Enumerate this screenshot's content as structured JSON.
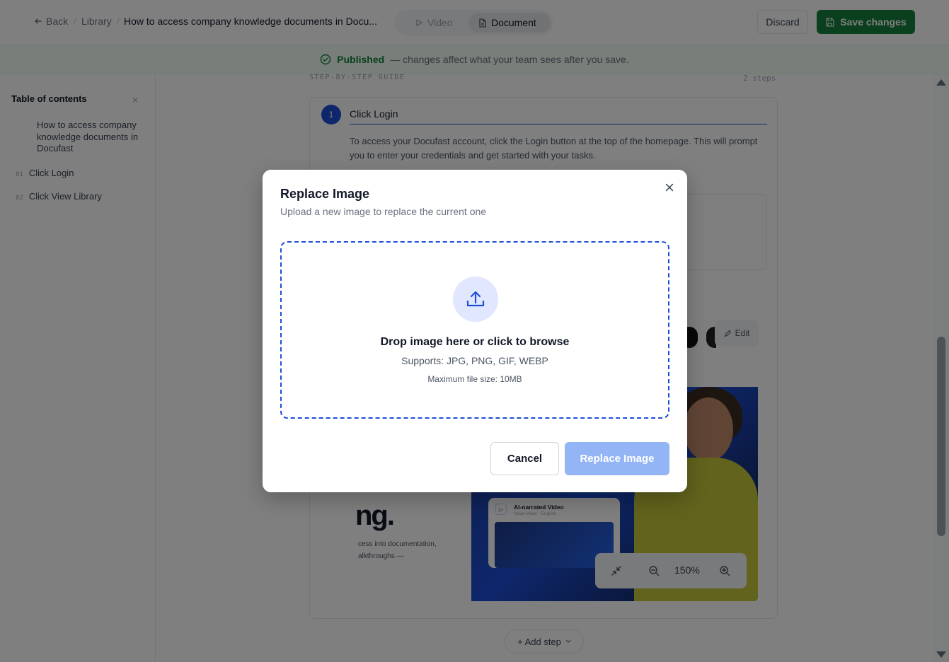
{
  "header": {
    "back_label": "Back",
    "breadcrumb_sep": "/",
    "library_label": "Library",
    "doc_title": "How to access company knowledge documents in Docu...",
    "view_toggle": {
      "video_label": "Video",
      "document_label": "Document"
    },
    "discard_label": "Discard",
    "save_label": "Save changes"
  },
  "banner": {
    "status": "Published",
    "message": "— changes affect what your team sees after you save."
  },
  "sidebar": {
    "title": "Table of contents",
    "close_glyph": "×",
    "main_item": "How to access company knowledge documents in Docufast",
    "items": [
      {
        "num": "01",
        "label": "Click Login"
      },
      {
        "num": "02",
        "label": "Click View Library"
      }
    ]
  },
  "main": {
    "guide_label": "STEP-BY-STEP GUIDE",
    "steps_count": "2 steps",
    "step": {
      "number": "1",
      "title": "Click Login",
      "description": "To access your Docufast account, click the Login button at the top of the homepage. This will prompt you to enter your credentials and get started with your tasks.",
      "edit_label": "Edit"
    },
    "screenshot": {
      "big_text": "ng.",
      "small_line_1": "cess into documentation,",
      "small_line_2": "alkthroughs —",
      "video_title": "AI-narrated Video",
      "video_sub": "Nova Voice · English"
    },
    "zoom_value": "150%",
    "add_step_label": "+ Add step"
  },
  "modal": {
    "title": "Replace Image",
    "subtitle": "Upload a new image to replace the current one",
    "drop_main": "Drop image here or click to browse",
    "drop_types": "Supports: JPG, PNG, GIF, WEBP",
    "drop_size": "Maximum file size: 10MB",
    "cancel_label": "Cancel",
    "replace_label": "Replace Image"
  },
  "colors": {
    "primary": "#1d4ed8",
    "save_green": "#15803d",
    "replace_disabled": "#93b4f5"
  }
}
